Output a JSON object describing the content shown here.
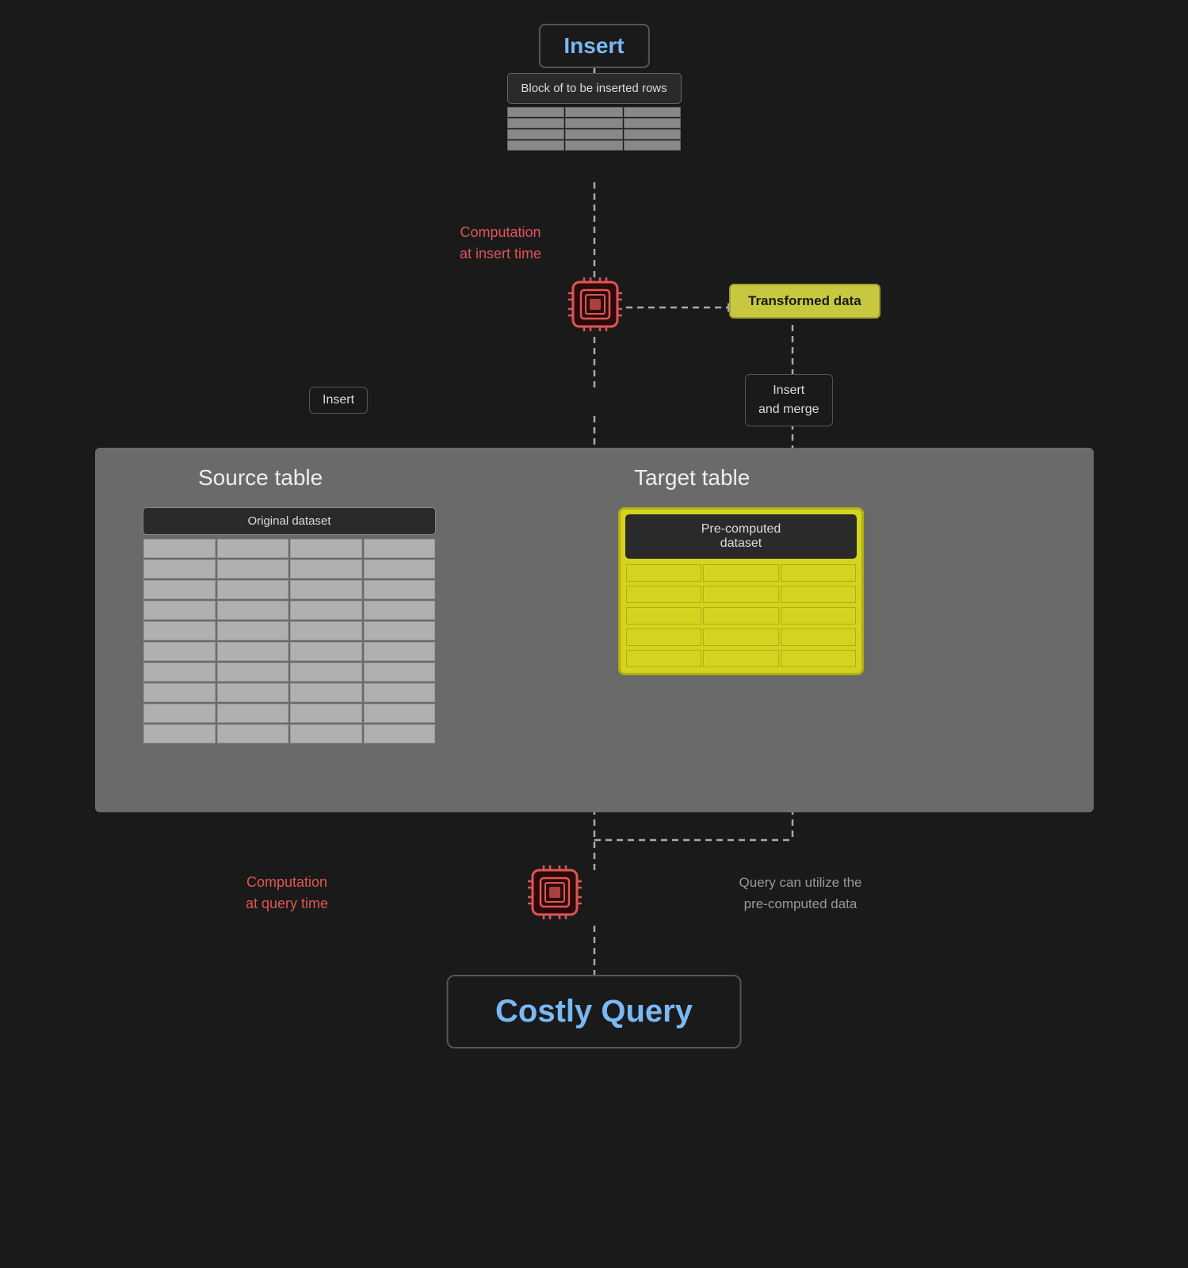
{
  "insert_node": {
    "label": "Insert"
  },
  "insert_block": {
    "label": "Block of to be inserted rows"
  },
  "computation_insert": {
    "label": "Computation\nat insert time"
  },
  "transformed_data": {
    "label": "Transformed data"
  },
  "insert_left": {
    "label": "Insert"
  },
  "insert_merge": {
    "label": "Insert\nand merge"
  },
  "source_table": {
    "title": "Source table",
    "dataset_label": "Original dataset"
  },
  "target_table": {
    "title": "Target table",
    "dataset_label": "Pre-computed\ndataset"
  },
  "computation_query": {
    "label": "Computation\nat query time"
  },
  "query_utilize": {
    "label": "Query can utilize the\npre-computed data"
  },
  "costly_query": {
    "label": "Costly Query"
  },
  "colors": {
    "accent_blue": "#7ab8f5",
    "accent_red": "#e05555",
    "accent_yellow": "#d4d420",
    "dark_bg": "#1a1a1a",
    "panel_bg": "#666",
    "text_light": "#eeeeee",
    "text_gray": "#999999"
  }
}
